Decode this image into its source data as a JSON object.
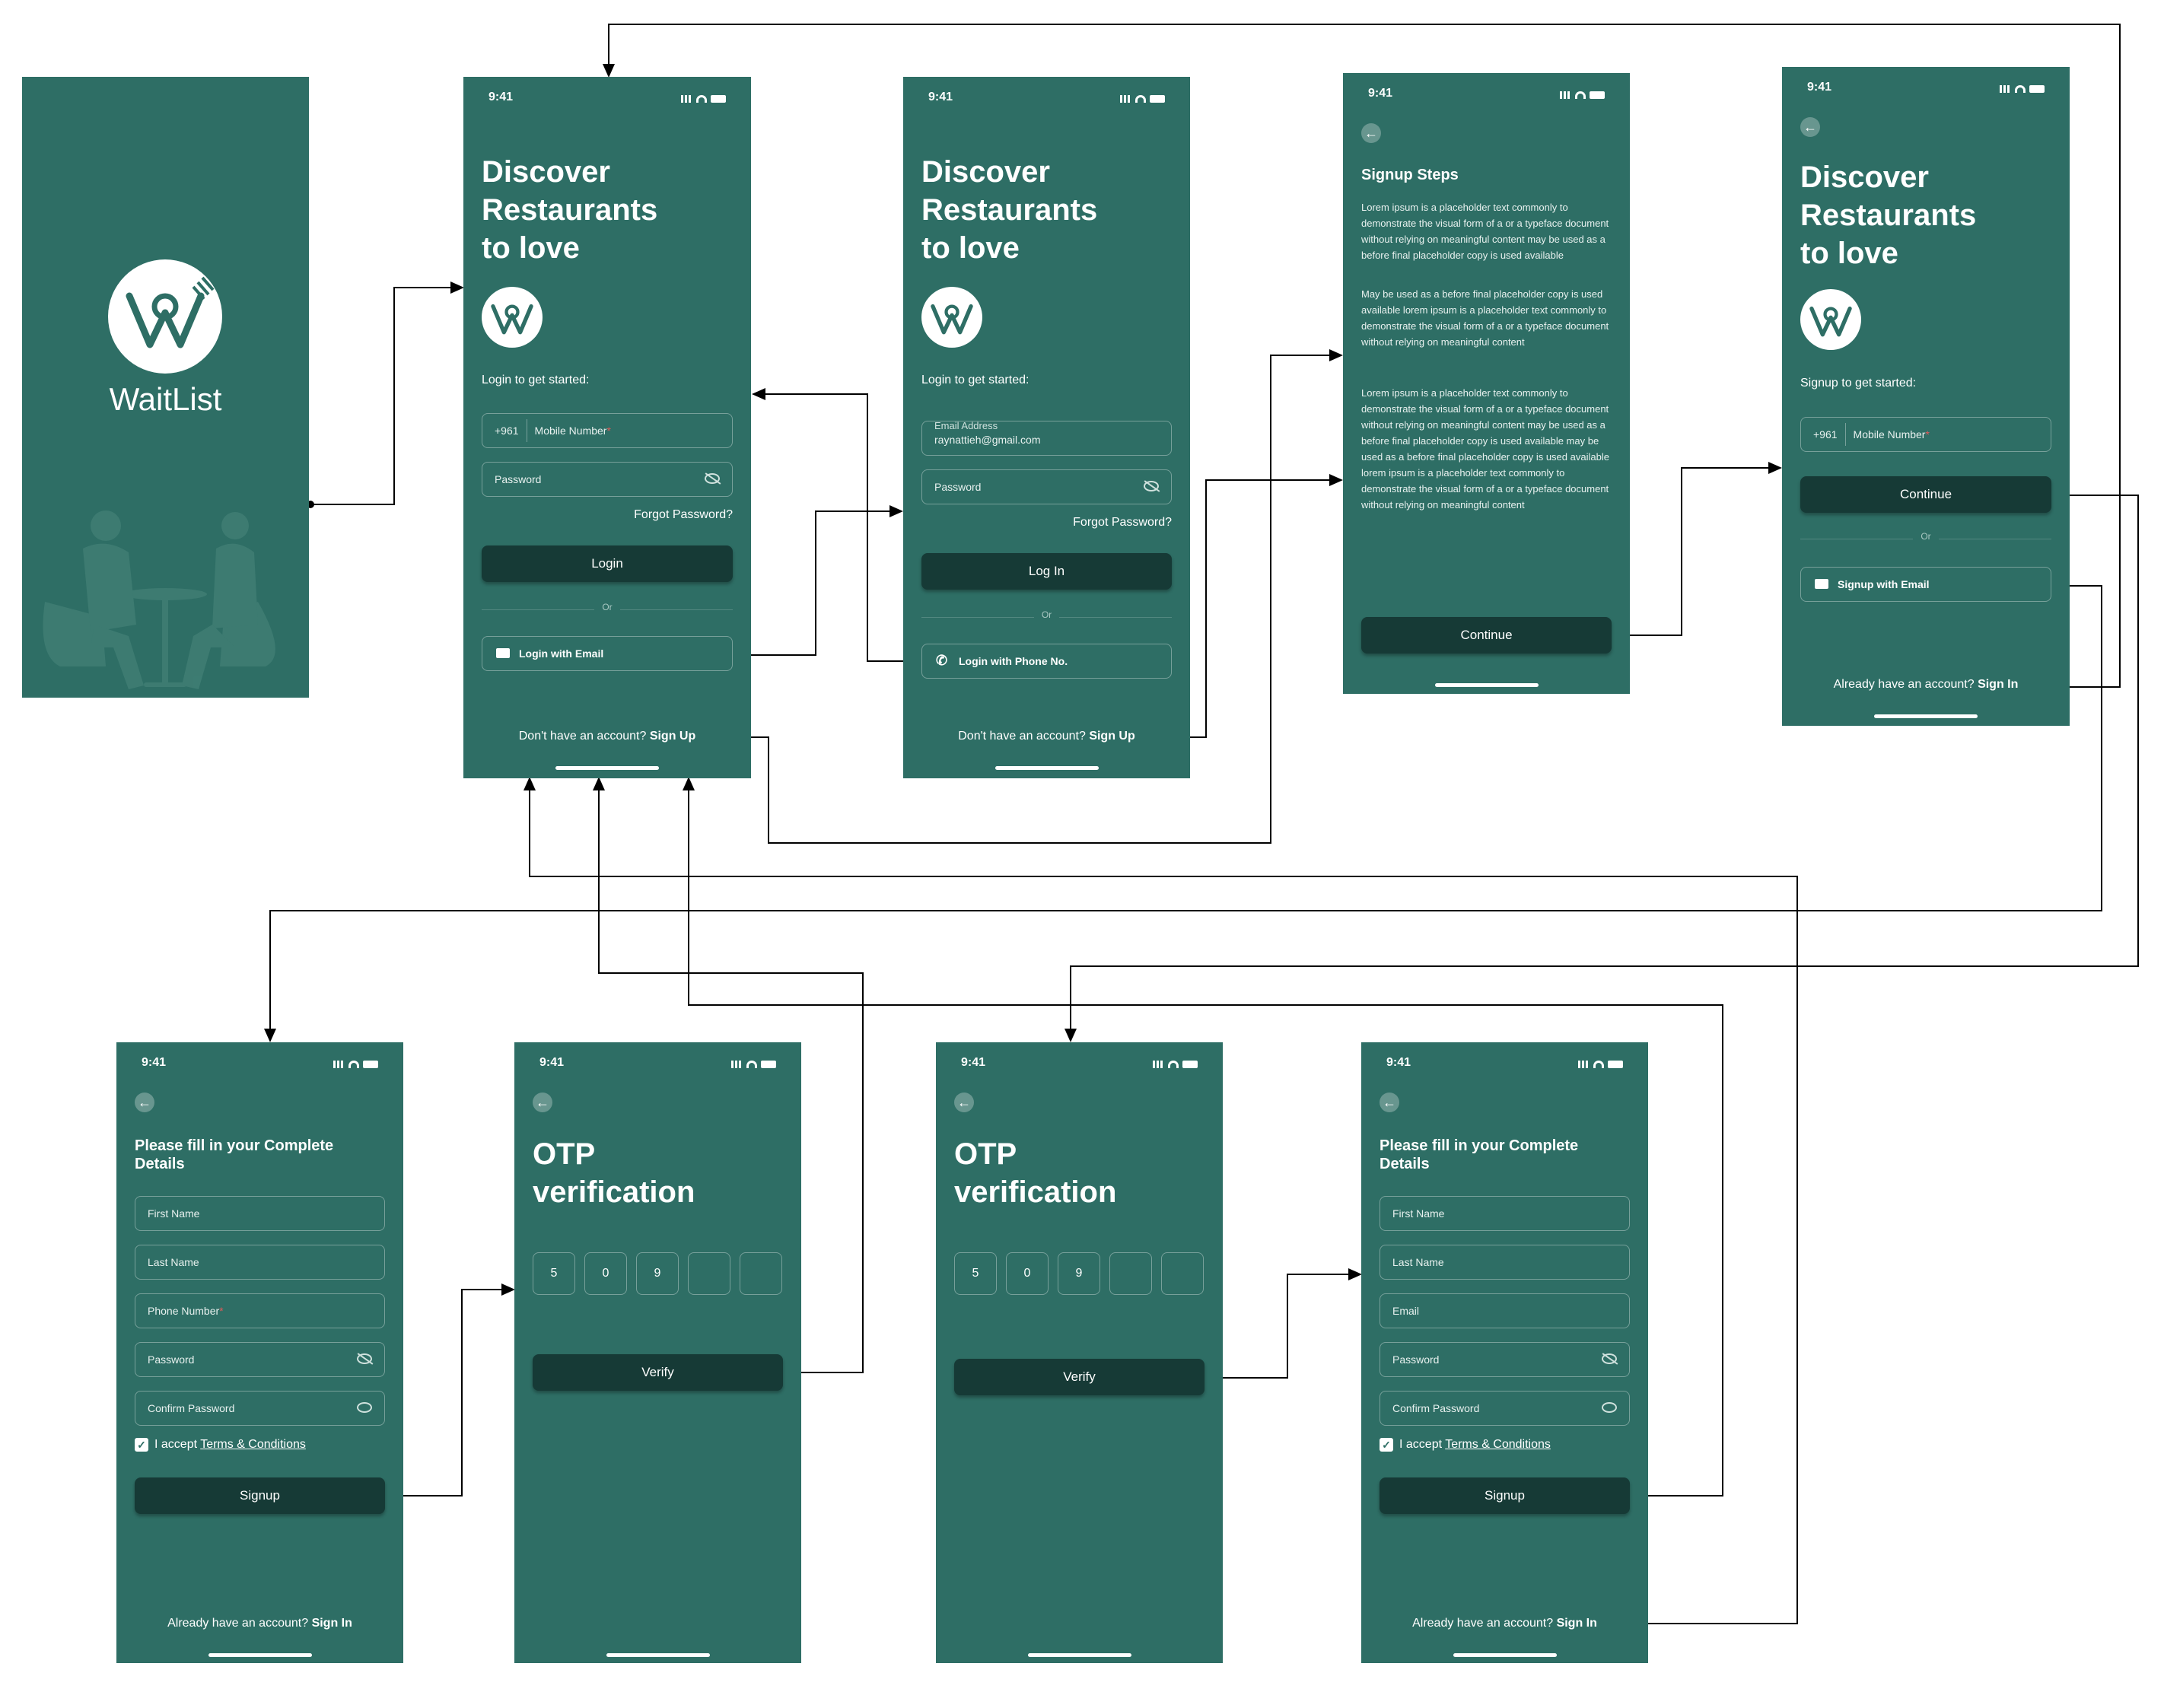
{
  "time": "9:41",
  "splash": {
    "brand": "WaitList"
  },
  "login_phone": {
    "title": "Discover\nRestaurants\nto love",
    "prompt": "Login to get started:",
    "country_code": "+961",
    "mobile_placeholder": "Mobile Number",
    "required_mark": "*",
    "password_placeholder": "Password",
    "forgot": "Forgot Password?",
    "login_button": "Login",
    "or": "Or",
    "alt_button": "Login with Email",
    "bottom_text": "Don't have an account?",
    "bottom_link": "Sign Up"
  },
  "login_email": {
    "title": "Discover\nRestaurants\nto love",
    "prompt": "Login to get started:",
    "email_label": "Email Address",
    "email_value": "raynattieh@gmail.com",
    "password_placeholder": "Password",
    "forgot": "Forgot Password?",
    "login_button": "Log In",
    "or": "Or",
    "alt_button": "Login with Phone No.",
    "bottom_text": "Don't have an account?",
    "bottom_link": "Sign Up"
  },
  "signup_steps": {
    "title": "Signup Steps",
    "p1": "Lorem ipsum is a placeholder text commonly to demonstrate the visual form of a or a typeface document without relying on meaningful content may be used as a before final placeholder copy is used available",
    "p2": "May be used as a before final placeholder copy is used available lorem ipsum is a placeholder text commonly to demonstrate the visual form of a or a typeface document without relying on meaningful content",
    "p3": "Lorem ipsum is a placeholder text commonly to demonstrate the visual form of a or a typeface document without relying on meaningful content may be used as a before final placeholder copy is used available may be used as a before final placeholder copy is used available lorem ipsum is a placeholder text commonly to demonstrate the visual form of a or a typeface document without relying on meaningful content",
    "button": "Continue"
  },
  "signup_phone": {
    "title": "Discover\nRestaurants\nto love",
    "prompt": "Signup to get started:",
    "country_code": "+961",
    "mobile_placeholder": "Mobile Number",
    "required_mark": "*",
    "continue_button": "Continue",
    "or": "Or",
    "alt_button": "Signup with Email",
    "bottom_text": "Already have an account?",
    "bottom_link": "Sign In"
  },
  "details_a": {
    "title": "Please fill in your Complete\nDetails",
    "first_name": "First Name",
    "last_name": "Last Name",
    "third": "Phone Number",
    "required_mark": "*",
    "password": "Password",
    "confirm": "Confirm Password",
    "accept": "I accept",
    "terms": "Terms & Conditions",
    "button": "Signup",
    "bottom_text": "Already have an account?",
    "bottom_link": "Sign In"
  },
  "otp_a": {
    "title": "OTP\nverification",
    "digits": [
      "5",
      "0",
      "9",
      "",
      ""
    ],
    "button": "Verify"
  },
  "otp_b": {
    "title": "OTP\nverification",
    "digits": [
      "5",
      "0",
      "9",
      "",
      ""
    ],
    "button": "Verify"
  },
  "details_b": {
    "title": "Please fill in your Complete\nDetails",
    "first_name": "First Name",
    "last_name": "Last Name",
    "third": "Email",
    "password": "Password",
    "confirm": "Confirm Password",
    "accept": "I accept",
    "terms": "Terms & Conditions",
    "button": "Signup",
    "bottom_text": "Already have an account?",
    "bottom_link": "Sign In"
  },
  "colors": {
    "screen": "#2e6e65",
    "button": "#163a36",
    "background": "#ffffff",
    "wire": "#000000"
  }
}
